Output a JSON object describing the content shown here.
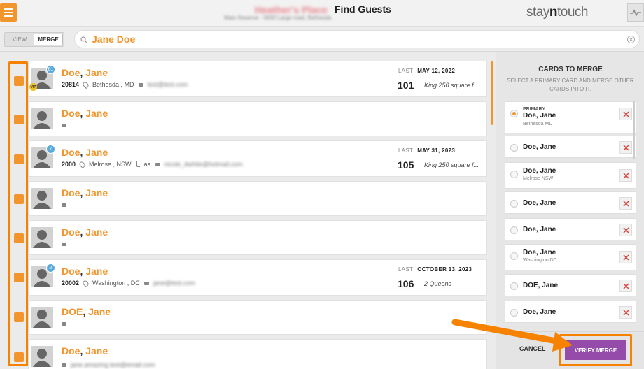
{
  "header": {
    "hotel_name": "Heather's Place",
    "hotel_sub": "Main Reserve · 0000 Large road, Bethesda",
    "title": "Find Guests",
    "logo_pre": "stay",
    "logo_mid": "n",
    "logo_post": "touch"
  },
  "toolbar": {
    "view_label": "VIEW",
    "merge_label": "MERGE",
    "search_value": "Jane Doe"
  },
  "guests": [
    {
      "last": "Doe",
      "first": "Jane",
      "badge": "61",
      "vip": "VIP",
      "zip": "20814",
      "location": "Bethesda , MD",
      "phone": "",
      "email": "test@test.com",
      "last_label": "LAST",
      "last_date": "MAY 12, 2022",
      "room": "101",
      "room_type": "King 250 square f..."
    },
    {
      "last": "Doe",
      "first": "Jane"
    },
    {
      "last": "Doe",
      "first": "Jane",
      "badge": "7",
      "zip": "2000",
      "location": "Melrose , NSW",
      "phone": "aa",
      "email": "nicole_dwhite@hotmail.com",
      "last_label": "LAST",
      "last_date": "MAY 31, 2023",
      "room": "105",
      "room_type": "King 250 square f..."
    },
    {
      "last": "Doe",
      "first": "Jane"
    },
    {
      "last": "Doe",
      "first": "Jane"
    },
    {
      "last": "Doe",
      "first": "Jane",
      "badge": "2",
      "zip": "20002",
      "location": "Washington , DC",
      "phone": "",
      "email": "jane@test.com",
      "last_label": "LAST",
      "last_date": "OCTOBER 13, 2023",
      "room": "106",
      "room_type": "2 Queens"
    },
    {
      "last": "DOE",
      "first": "Jane"
    },
    {
      "last": "Doe",
      "first": "Jane",
      "email": "jane.amazing.test@email.com"
    }
  ],
  "merge_panel": {
    "title": "CARDS TO MERGE",
    "subtitle": "SELECT A PRIMARY CARD AND MERGE OTHER CARDS INTO IT.",
    "primary_label": "PRIMARY",
    "cards": [
      {
        "name": "Doe, Jane",
        "location": "Bethesda MD"
      },
      {
        "name": "Doe, Jane",
        "location": ""
      },
      {
        "name": "Doe, Jane",
        "location": "Melrose NSW"
      },
      {
        "name": "Doe, Jane",
        "location": ""
      },
      {
        "name": "Doe, Jane",
        "location": ""
      },
      {
        "name": "Doe, Jane",
        "location": "Washington DC"
      },
      {
        "name": "DOE, Jane",
        "location": ""
      },
      {
        "name": "Doe, Jane",
        "location": ""
      }
    ],
    "cancel_label": "CANCEL",
    "verify_label": "VERIFY MERGE"
  },
  "colors": {
    "accent": "#f1952c",
    "highlight": "#f78200",
    "verify": "#944ba9"
  }
}
